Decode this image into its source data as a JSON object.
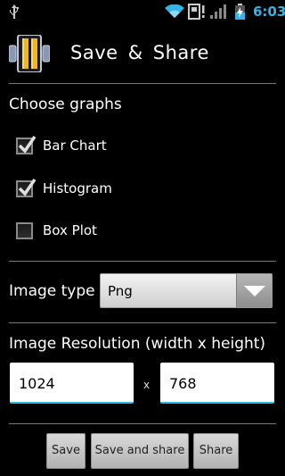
{
  "status_bar": {
    "time": "6:03",
    "time_color": "#33b5e5",
    "icons": [
      "usb-icon",
      "wifi-icon",
      "sim-icon",
      "signal-icon",
      "battery-charging-icon"
    ]
  },
  "header": {
    "title": "Save & Share",
    "app_icon": "app-logo-icon"
  },
  "graphs": {
    "label": "Choose graphs",
    "options": [
      {
        "label": "Bar Chart",
        "checked": true
      },
      {
        "label": "Histogram",
        "checked": true
      },
      {
        "label": "Box Plot",
        "checked": false
      }
    ]
  },
  "image_type": {
    "label": "Image type",
    "selected": "Png"
  },
  "resolution": {
    "label": "Image Resolution (width x height)",
    "width": "1024",
    "separator": "x",
    "height": "768",
    "focus_color": "#33b5e5"
  },
  "actions": {
    "save_label": "Save",
    "save_share_label": "Save and share",
    "share_label": "Share"
  }
}
